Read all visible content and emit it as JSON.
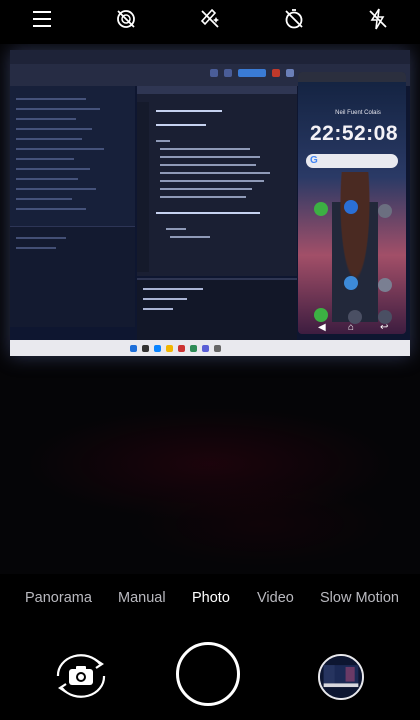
{
  "top_controls": {
    "menu_icon": "hamburger-menu-icon",
    "hdr_icon": "hdr-off-icon",
    "ai_icon": "ai-scene-off-icon",
    "timer_icon": "timer-off-icon",
    "flash_icon": "flash-off-icon"
  },
  "preview": {
    "phone_clock": "22:52:08",
    "phone_name": "Neil Fuent Colais"
  },
  "modes": [
    {
      "label": "Panorama",
      "active": false
    },
    {
      "label": "Manual",
      "active": false
    },
    {
      "label": "Photo",
      "active": true
    },
    {
      "label": "Video",
      "active": false
    },
    {
      "label": "Slow Motion",
      "active": false
    }
  ],
  "bottom_controls": {
    "switch_camera_icon": "camera-switch-icon",
    "shutter_icon": "shutter-button",
    "gallery_icon": "gallery-thumbnail"
  },
  "colors": {
    "background": "#000000",
    "mode_active": "#ffffff",
    "mode_inactive": "#b9b9bf"
  }
}
